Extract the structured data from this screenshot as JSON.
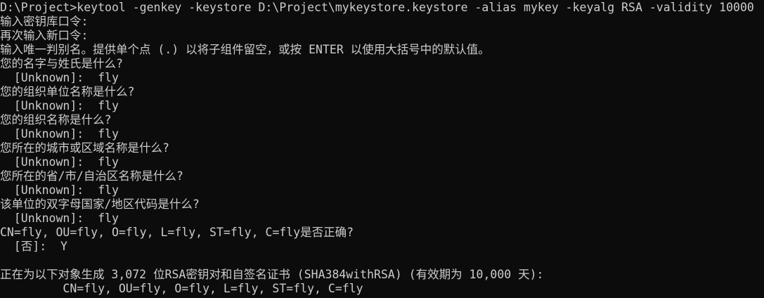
{
  "terminal": {
    "background": "#0c0c0c",
    "foreground": "#cccccc",
    "lines": [
      "D:\\Project>keytool -genkey -keystore D:\\Project\\mykeystore.keystore -alias mykey -keyalg RSA -validity 10000",
      "输入密钥库口令:",
      "再次输入新口令:",
      "输入唯一判别名。提供单个点 (.) 以将子组件留空，或按 ENTER 以使用大括号中的默认值。",
      "您的名字与姓氏是什么?",
      "  [Unknown]:  fly",
      "您的组织单位名称是什么?",
      "  [Unknown]:  fly",
      "您的组织名称是什么?",
      "  [Unknown]:  fly",
      "您所在的城市或区域名称是什么?",
      "  [Unknown]:  fly",
      "您所在的省/市/自治区名称是什么?",
      "  [Unknown]:  fly",
      "该单位的双字母国家/地区代码是什么?",
      "  [Unknown]:  fly",
      "CN=fly, OU=fly, O=fly, L=fly, ST=fly, C=fly是否正确?",
      "  [否]:  Y",
      "",
      "正在为以下对象生成 3,072 位RSA密钥对和自签名证书 (SHA384withRSA) (有效期为 10,000 天):",
      "         CN=fly, OU=fly, O=fly, L=fly, ST=fly, C=fly"
    ]
  }
}
